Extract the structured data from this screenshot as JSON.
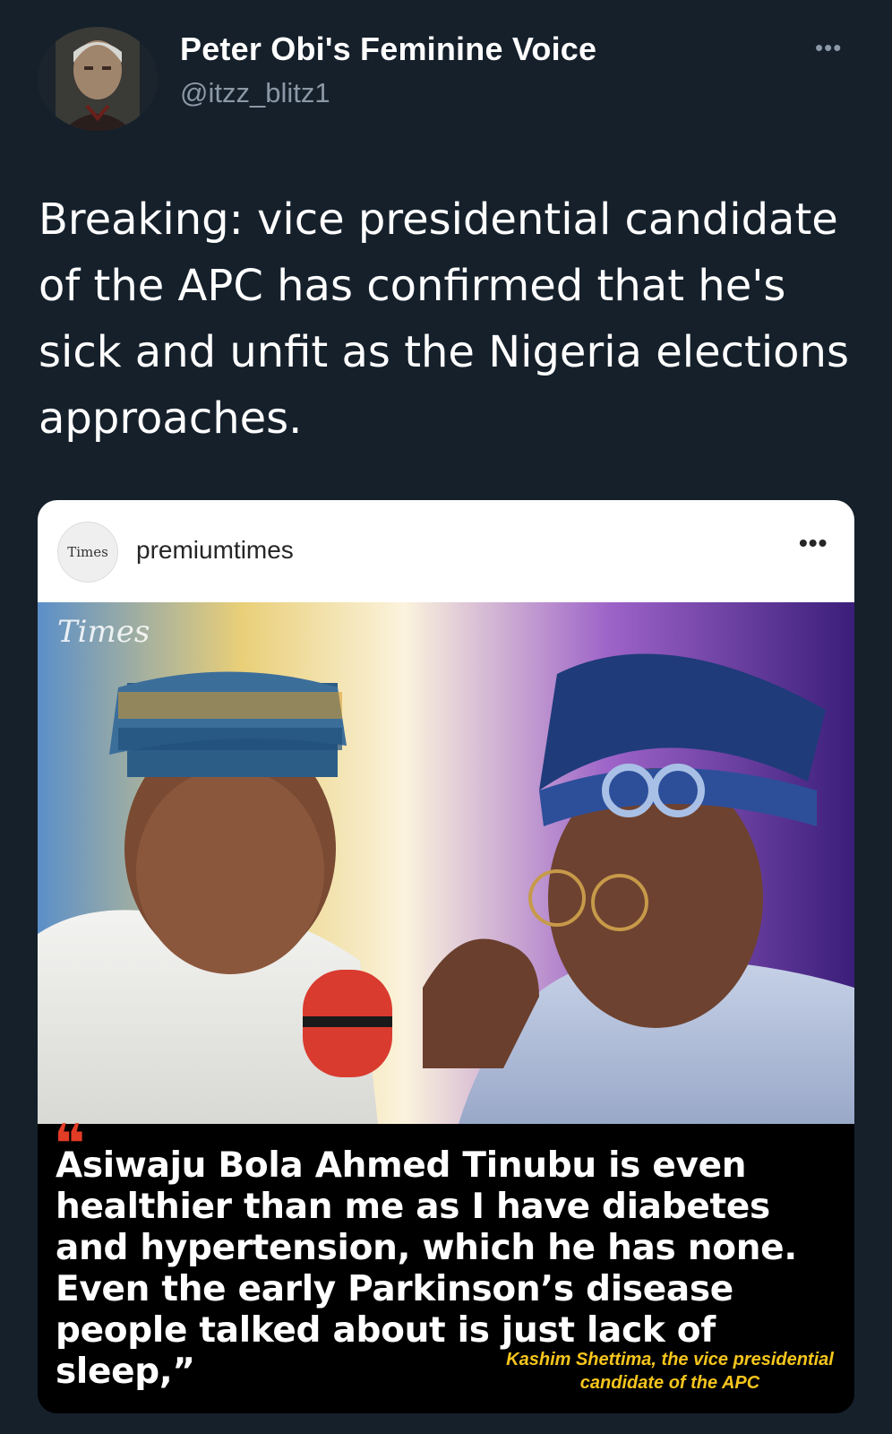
{
  "user": {
    "display_name": "Peter Obi's Feminine Voice",
    "handle": "@itzz_blitz1",
    "more_icon": "more-dots-icon"
  },
  "tweet": {
    "text": "Breaking: vice presidential candidate of the APC has confirmed that he's sick and unfit as the Nigeria elections approaches."
  },
  "embed": {
    "account": "premiumtimes",
    "logo_text": "Times",
    "watermark": "Times",
    "quote": "Asiwaju Bola Ahmed Tinubu is even healthier than me as I have diabetes and hypertension, which he has none. Even the early Parkinson’s disease people talked about is just lack of sleep,”",
    "attribution": "Kashim Shettima, the vice presidential candidate of the APC"
  },
  "colors": {
    "background": "#15202b",
    "secondary_text": "#8b98a5",
    "quote_mark": "#e23b26",
    "attribution": "#f6c51c"
  }
}
